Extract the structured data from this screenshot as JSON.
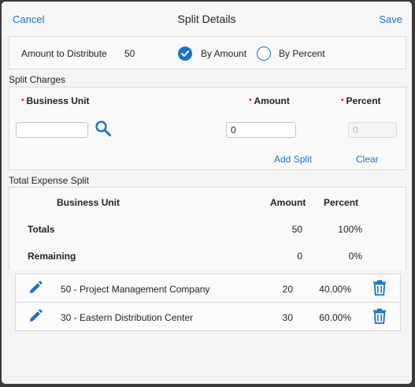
{
  "header": {
    "cancel": "Cancel",
    "title": "Split Details",
    "save": "Save"
  },
  "distribution": {
    "label": "Amount to Distribute",
    "value": "50",
    "by_amount": "By Amount",
    "by_amount_selected": true,
    "by_percent": "By Percent",
    "by_percent_selected": false
  },
  "split_charges": {
    "title": "Split Charges",
    "business_unit_label": "Business Unit",
    "amount_label": "Amount",
    "percent_label": "Percent",
    "business_unit_value": "",
    "amount_value": "0",
    "percent_placeholder": "0",
    "add_split": "Add Split",
    "clear": "Clear"
  },
  "total_split": {
    "title": "Total Expense Split",
    "headers": {
      "business_unit": "Business Unit",
      "amount": "Amount",
      "percent": "Percent"
    },
    "totals": {
      "label": "Totals",
      "amount": "50",
      "percent": "100%"
    },
    "remaining": {
      "label": "Remaining",
      "amount": "0",
      "percent": "0%"
    }
  },
  "splits": [
    {
      "name": "50 - Project Management Company",
      "amount": "20",
      "percent": "40.00%"
    },
    {
      "name": "30 - Eastern Distribution Center",
      "amount": "30",
      "percent": "60.00%"
    }
  ],
  "colors": {
    "accent": "#1a73c8",
    "required": "#dd2233"
  },
  "icons": [
    "checkmark-icon",
    "search-icon",
    "pencil-icon",
    "trash-icon"
  ]
}
